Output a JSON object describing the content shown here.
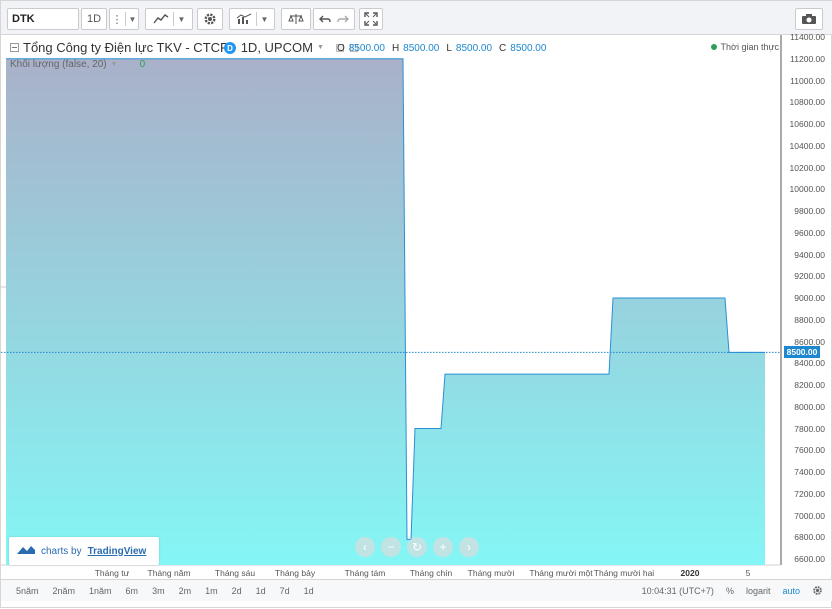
{
  "toolbar": {
    "symbol": "DTK",
    "interval": "1D",
    "icons": [
      "more-icon",
      "chart-style-icon",
      "settings-icon",
      "indicators-icon",
      "compare-icon",
      "undo-icon",
      "redo-icon",
      "fullscreen-icon",
      "camera-icon"
    ]
  },
  "legend": {
    "title": "Tổng Công ty Điện lực TKV - CTCP, 1D, UPCOM",
    "title_before_badge": "Tổng Công ty Điện lực TKV - CTCP",
    "title_after_badge": "1D, UPCOM",
    "badge": "D",
    "ohlc": [
      {
        "k": "O",
        "v": "8500.00"
      },
      {
        "k": "H",
        "v": "8500.00"
      },
      {
        "k": "L",
        "v": "8500.00"
      },
      {
        "k": "C",
        "v": "8500.00"
      }
    ],
    "realtime": "Thời gian thực",
    "volume_label": "Khối lượng (false, 20)",
    "volume_value": "0"
  },
  "price_axis": {
    "ticks": [
      "11400.00",
      "11200.00",
      "11000.00",
      "10800.00",
      "10600.00",
      "10400.00",
      "10200.00",
      "10000.00",
      "9800.00",
      "9600.00",
      "9400.00",
      "9200.00",
      "9000.00",
      "8800.00",
      "8600.00",
      "8400.00",
      "8200.00",
      "8000.00",
      "7800.00",
      "7600.00",
      "7400.00",
      "7200.00",
      "7000.00",
      "6800.00",
      "6600.00"
    ],
    "last_price": "8500.00"
  },
  "time_axis": [
    {
      "label": "Tháng tư",
      "bold": false
    },
    {
      "label": "Tháng năm",
      "bold": false
    },
    {
      "label": "Tháng sáu",
      "bold": false
    },
    {
      "label": "Tháng bảy",
      "bold": false
    },
    {
      "label": "Tháng tám",
      "bold": false
    },
    {
      "label": "Tháng chín",
      "bold": false
    },
    {
      "label": "Tháng mười",
      "bold": false
    },
    {
      "label": "Tháng mười một",
      "bold": false
    },
    {
      "label": "Tháng mười hai",
      "bold": false
    },
    {
      "label": "2020",
      "bold": true
    },
    {
      "label": "5",
      "bold": false
    }
  ],
  "watermark": {
    "prefix": "charts by",
    "brand": "TradingView"
  },
  "bottom": {
    "ranges": [
      "5năm",
      "2năm",
      "1năm",
      "6m",
      "3m",
      "2m",
      "1m",
      "2d",
      "1d",
      "7d",
      "1d"
    ],
    "time": "10:04:31 (UTC+7)",
    "percent": "%",
    "log": "logarit",
    "auto": "auto"
  },
  "chart_data": {
    "type": "area",
    "series": [
      {
        "name": "DTK",
        "segments": [
          {
            "from": "start",
            "to": "Aug",
            "value": 11200
          },
          {
            "at": "early Sep",
            "value": 6800
          },
          {
            "at": "Sep",
            "value": 7800
          },
          {
            "at": "Oct",
            "value": 8300
          },
          {
            "at": "Nov",
            "value": 8300
          },
          {
            "at": "Dec",
            "value": 9000
          },
          {
            "at": "Jan 2020",
            "value": 9000
          },
          {
            "at": "Jan 2020 late",
            "value": 8500
          }
        ]
      }
    ],
    "ylim": [
      6500,
      11450
    ],
    "colors": {
      "area_top": "#a9b1c9",
      "area_bottom": "#84f6f5",
      "line": "#2b8fd6",
      "volume": "#3fd6a3"
    }
  }
}
